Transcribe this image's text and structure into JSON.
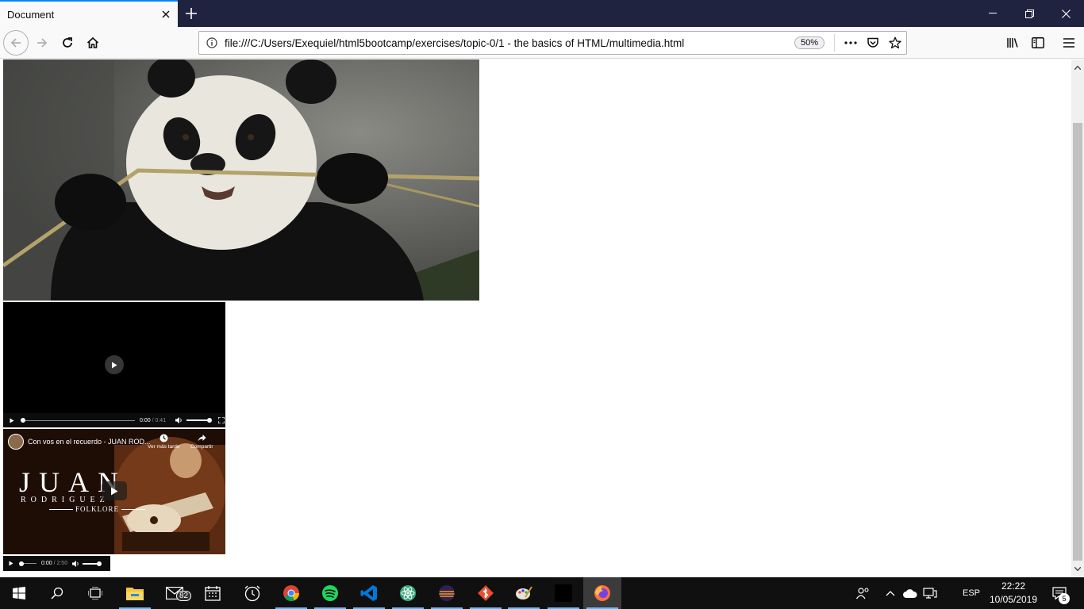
{
  "tab": {
    "title": "Document"
  },
  "url": {
    "text": "file:///C:/Users/Exequiel/html5bootcamp/exercises/topic-0/1 - the basics of HTML/multimedia.html",
    "zoom": "50%"
  },
  "video": {
    "current": "0:00",
    "duration": "0:41",
    "progress": 0
  },
  "youtube": {
    "title": "Con vos en el recuerdo - JUAN ROD...",
    "watch_later": "Ver más tarde",
    "share": "Compartir",
    "thumb_line1": "JUAN",
    "thumb_line2": "RODRIGUEZ",
    "thumb_line3": "FOLKLORE"
  },
  "audio": {
    "current": "0:00",
    "duration": "2:50",
    "progress": 0
  },
  "taskbar": {
    "mail_badge": "82",
    "language": "ESP",
    "time": "22:22",
    "date": "10/05/2019",
    "notifications": "5"
  }
}
